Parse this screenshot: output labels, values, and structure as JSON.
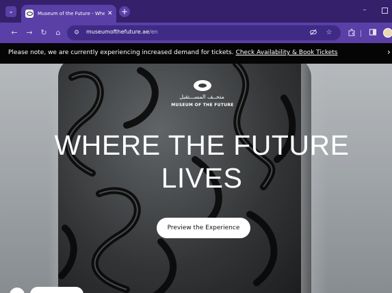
{
  "browser": {
    "tab": {
      "title": "Museum of the Future - Where Th",
      "close_glyph": "✕"
    },
    "new_tab_glyph": "+",
    "tab_search_glyph": "⌄",
    "window": {
      "minimize_glyph": "–"
    },
    "toolbar": {
      "back_glyph": "←",
      "forward_glyph": "→",
      "reload_glyph": "↻",
      "home_glyph": "⌂",
      "site_info_glyph": "⚙",
      "url_host": "museumofthefuture.ae",
      "url_path": "/en",
      "icons": [
        "eye-off-icon",
        "star-icon",
        "extensions-icon",
        "sidepanel-icon",
        "profile-avatar"
      ]
    }
  },
  "notice": {
    "text": "Please note, we are currently experiencing increased demand for tickets.",
    "link": "Check Availability & Book Tickets",
    "arrow_glyph": "›"
  },
  "hero": {
    "logo": {
      "arabic": "متحــف المســـتقبل",
      "english": "MUSEUM OF THE FUTURE"
    },
    "headline_line1": "WHERE THE FUTURE",
    "headline_line2": "LIVES",
    "cta_label": "Preview the Experience"
  },
  "colors": {
    "tab_strip": "#35206b",
    "toolbar": "#5a3fa6",
    "omnibox": "#3f2b86",
    "notice_bar": "#050505"
  }
}
